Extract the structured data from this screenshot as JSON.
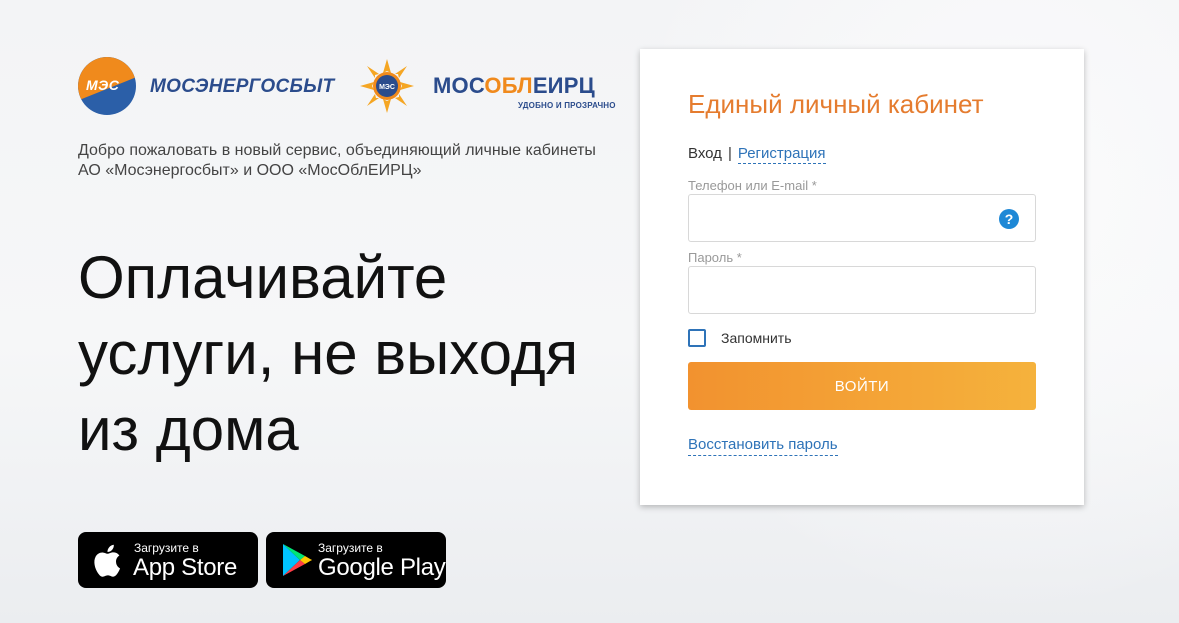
{
  "logos": {
    "mes_badge": "МЭС",
    "mes_name": "МОСЭНЕРГОСБЫТ",
    "mosobl_badge": "МЭС",
    "mosobl_name_part1": "МОС",
    "mosobl_name_part2": "ОБЛ",
    "mosobl_name_part3": "ЕИРЦ",
    "mosobl_slogan": "УДОБНО И ПРОЗРАЧНО"
  },
  "welcome_text": "Добро пожаловать в новый сервис, объединяющий личные кабинеты АО «Мосэнергосбыт» и ООО «МосОблЕИРЦ»",
  "headline": "Оплачивайте услуги, не выходя из дома",
  "stores": {
    "apple": {
      "small": "Загрузите в",
      "big": "App Store",
      "icon": "apple-icon"
    },
    "google": {
      "small": "Загрузите в",
      "big": "Google Play",
      "icon": "google-play-icon"
    }
  },
  "login": {
    "title": "Единый личный кабинет",
    "tab_login": "Вход",
    "tab_separator": "|",
    "tab_register": "Регистрация",
    "phone_label": "Телефон или E-mail *",
    "phone_value": "",
    "help_icon": "?",
    "password_label": "Пароль *",
    "password_value": "",
    "remember_label": "Запомнить",
    "remember_checked": false,
    "submit_label": "ВОЙТИ",
    "restore_link": "Восстановить пароль"
  },
  "colors": {
    "accent_orange": "#e57c2f",
    "link_blue": "#2e73b8",
    "brand_blue": "#2b4c8c"
  }
}
